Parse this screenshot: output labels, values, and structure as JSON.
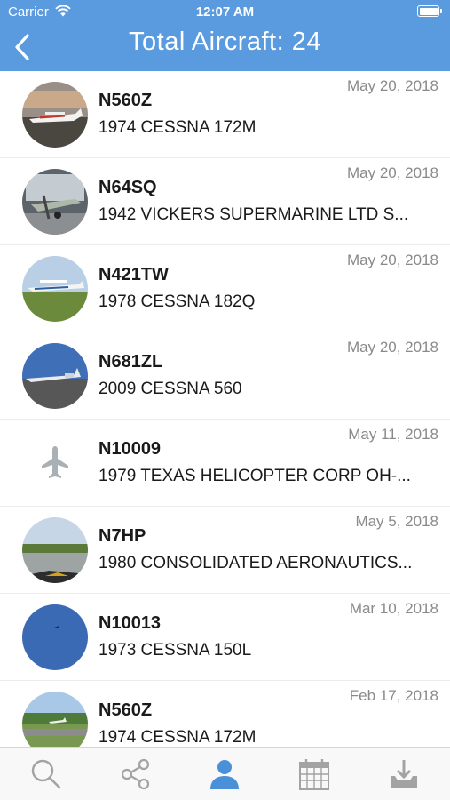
{
  "status_bar": {
    "carrier": "Carrier",
    "time": "12:07 AM"
  },
  "nav": {
    "title": "Total Aircraft: 24"
  },
  "aircraft": [
    {
      "tail": "N560Z",
      "model": "1974 CESSNA 172M",
      "date": "May 20, 2018",
      "photo": "photo"
    },
    {
      "tail": "N64SQ",
      "model": "1942 VICKERS SUPERMARINE LTD S...",
      "date": "May 20, 2018",
      "photo": "photo"
    },
    {
      "tail": "N421TW",
      "model": "1978 CESSNA 182Q",
      "date": "May 20, 2018",
      "photo": "photo"
    },
    {
      "tail": "N681ZL",
      "model": "2009 CESSNA 560",
      "date": "May 20, 2018",
      "photo": "photo"
    },
    {
      "tail": "N10009",
      "model": "1979 TEXAS HELICOPTER CORP OH-...",
      "date": "May 11, 2018",
      "photo": "airplane-icon"
    },
    {
      "tail": "N7HP",
      "model": "1980 CONSOLIDATED AERONAUTICS...",
      "date": "May 5, 2018",
      "photo": "photo"
    },
    {
      "tail": "N10013",
      "model": "1973 CESSNA 150L",
      "date": "Mar 10, 2018",
      "photo": "photo"
    },
    {
      "tail": "N560Z",
      "model": "1974 CESSNA 172M",
      "date": "Feb 17, 2018",
      "photo": "photo"
    }
  ],
  "tab_bar": {
    "active": "profile",
    "tabs": [
      "search-icon",
      "share-icon",
      "profile-icon",
      "calendar-icon",
      "download-icon"
    ]
  },
  "colors": {
    "header": "#5a9be0",
    "active_tab": "#4a90d9",
    "inactive_tab": "#a3a3a3"
  }
}
